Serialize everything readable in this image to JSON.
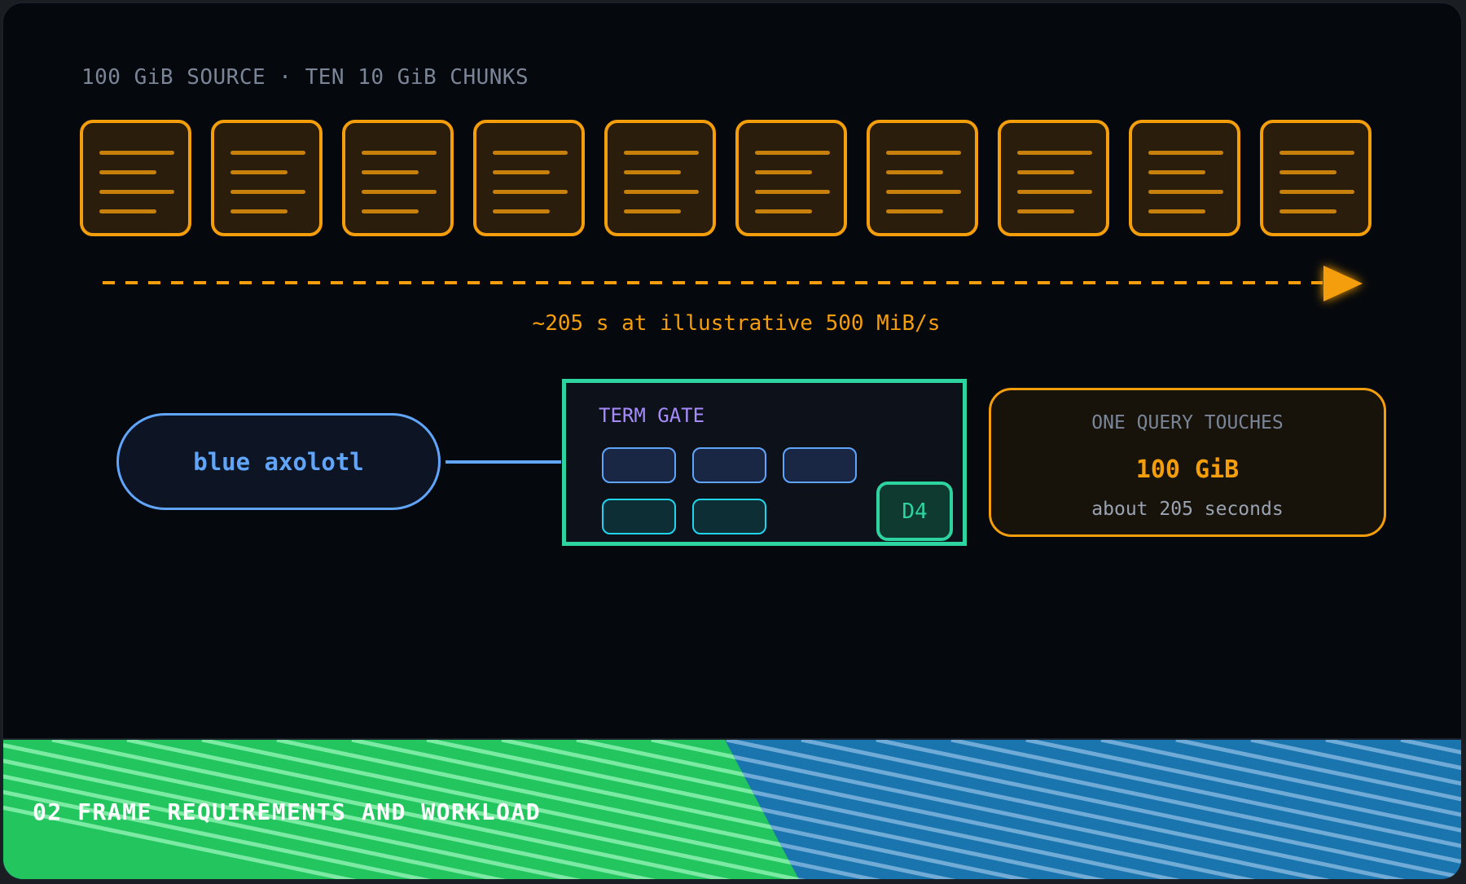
{
  "source": {
    "label": "100 GiB SOURCE · TEN 10 GiB CHUNKS",
    "chunk_count": 10
  },
  "scan": {
    "time_label": "~205 s at illustrative 500 MiB/s"
  },
  "query": {
    "text": "blue axolotl"
  },
  "term_gate": {
    "title": "TERM GATE",
    "slots": [
      "blue",
      "blue",
      "blue",
      "teal",
      "teal"
    ],
    "highlight_label": "D4"
  },
  "touch": {
    "heading": "ONE QUERY TOUCHES",
    "size": "100 GiB",
    "time": "about 205 seconds"
  },
  "banner": {
    "title": "02 FRAME REQUIREMENTS AND WORKLOAD"
  },
  "colors": {
    "accent_orange": "#f59e0b",
    "accent_blue": "#60a5fa",
    "accent_teal": "#2dd4a0",
    "banner_green": "#22c55e",
    "banner_blue": "#1a75ae"
  }
}
